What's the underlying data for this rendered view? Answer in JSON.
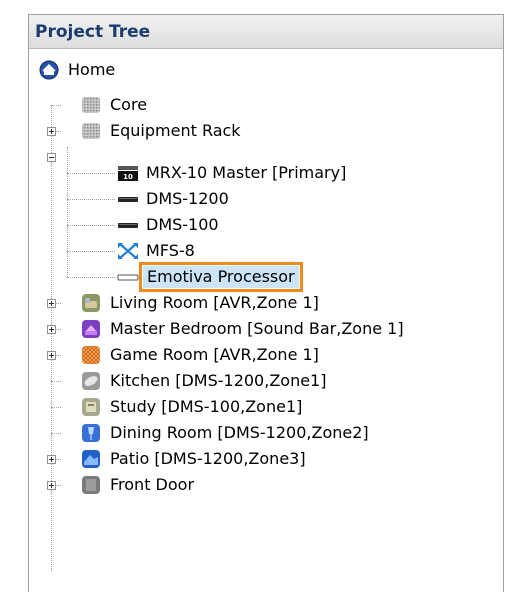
{
  "panel": {
    "title": "Project Tree"
  },
  "tree": {
    "home": "Home",
    "core": "Core",
    "equipment_rack": "Equipment Rack",
    "rack_children": [
      "MRX-10 Master [Primary]",
      "DMS-1200",
      "DMS-100",
      "MFS-8",
      "Emotiva Processor"
    ],
    "rooms": [
      "Living Room [AVR,Zone 1]",
      "Master Bedroom [Sound Bar,Zone 1]",
      "Game Room [AVR,Zone 1]",
      "Kitchen [DMS-1200,Zone1]",
      "Study [DMS-100,Zone1]",
      "Dining Room [DMS-1200,Zone2]",
      "Patio  [DMS-1200,Zone3]",
      "Front Door"
    ],
    "selected": "Emotiva Processor"
  }
}
